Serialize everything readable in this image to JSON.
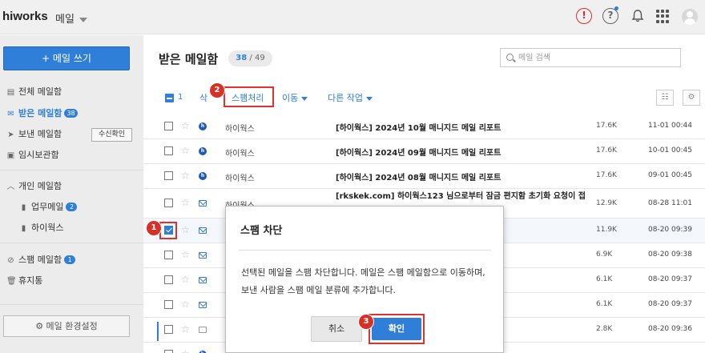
{
  "topbar": {
    "logo": "hiworks",
    "app_name": "메일",
    "alert_glyph": "!",
    "help_glyph": "?"
  },
  "sidebar": {
    "compose_label": "+ 메일 쓰기",
    "items": [
      {
        "icon": "inbox-all-icon",
        "label": "전체 메일함"
      },
      {
        "icon": "inbox-icon",
        "label": "받은 메일함",
        "badge": "38",
        "active": true
      },
      {
        "icon": "send-icon",
        "label": "보낸 메일함"
      },
      {
        "icon": "drafts-icon",
        "label": "임시보관함"
      },
      {
        "icon": "chevron-up-icon",
        "label": "개인 메일함"
      },
      {
        "icon": "bookmark-icon",
        "label": "업무메일",
        "badge": "2"
      },
      {
        "icon": "bookmark-icon",
        "label": "하이웍스"
      },
      {
        "icon": "block-icon",
        "label": "스팸 메일함",
        "badge": "1"
      },
      {
        "icon": "trash-icon",
        "label": "휴지통"
      }
    ],
    "receipt_button": "수신확인",
    "settings_button": "⚙ 메일 환경설정"
  },
  "main": {
    "title": "받은 메일함",
    "count_unread": "38",
    "count_sep": " / ",
    "count_total": "49",
    "search_placeholder": "메일 검색"
  },
  "toolbar": {
    "selected_count": "1",
    "delete_label": "삭",
    "spam_label": "스팸처리",
    "move_label": "이동",
    "more_label": "다른 작업",
    "list_view_glyph": "☷",
    "settings_glyph": "⚙"
  },
  "mails": [
    {
      "sender": "하이웍스",
      "subject": "[하이웍스] 2024년 10월 매니지드 메일 리포트",
      "size": "17.6K",
      "date": "11-01 00:44",
      "icon": "hiworks"
    },
    {
      "sender": "하이웍스",
      "subject": "[하이웍스] 2024년 09월 매니지드 메일 리포트",
      "size": "17.6K",
      "date": "10-01 00:45",
      "icon": "hiworks"
    },
    {
      "sender": "하이웍스",
      "subject": "[하이웍스] 2024년 08월 매니지드 메일 리포트",
      "size": "17.6K",
      "date": "09-01 00:45",
      "icon": "hiworks"
    },
    {
      "sender": "하이웍스",
      "subject": "[rkskek.com] 하이웍스123 님으로부터 잠금 편지함 초기화 요청이 접",
      "size": "12.9K",
      "date": "08-28 11:01",
      "icon": "envelope"
    },
    {
      "sender": "",
      "subject": "",
      "size": "11.9K",
      "date": "08-20 09:39",
      "icon": "envelope",
      "checked": true
    },
    {
      "sender": "",
      "subject": "",
      "size": "6.9K",
      "date": "08-20 09:38",
      "icon": "envelope"
    },
    {
      "sender": "",
      "subject": "",
      "size": "6.1K",
      "date": "08-20 09:37",
      "icon": "envelope"
    },
    {
      "sender": "",
      "subject": "",
      "size": "6.1K",
      "date": "08-20 09:37",
      "icon": "envelope"
    },
    {
      "sender": "",
      "subject": "",
      "size": "2.8K",
      "date": "08-20 09:36",
      "icon": "opened"
    }
  ],
  "dialog": {
    "title": "스팸 차단",
    "body": "선택된 메일을 스팸 차단합니다. 메일은 스팸 메일함으로 이동하며, 보낸 사람을 스팸 메일 분류에 추가합니다.",
    "cancel_label": "취소",
    "confirm_label": "확인"
  },
  "steps": [
    "1",
    "2",
    "3"
  ],
  "colors": {
    "accent": "#2f7fd8",
    "highlight": "#e03131",
    "step_badge": "#d93025"
  }
}
